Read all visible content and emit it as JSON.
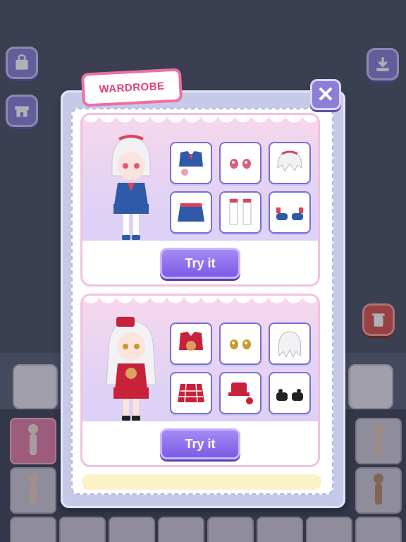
{
  "wardrobe": {
    "title": "WARDROBE",
    "close_label": "✕"
  },
  "outfits": [
    {
      "try_label": "Try it",
      "items": [
        "jacket-outfit-icon",
        "pink-eyes-icon",
        "white-hair-icon",
        "blue-skirt-icon",
        "white-socks-icon",
        "blue-shoes-icon"
      ]
    },
    {
      "try_label": "Try it",
      "items": [
        "red-plaid-jacket-icon",
        "gold-eyes-icon",
        "long-white-hair-icon",
        "red-plaid-skirt-icon",
        "red-hat-icon",
        "black-shoes-icon"
      ]
    }
  ],
  "colors": {
    "accent": "#8b7fd6",
    "title_pink": "#e0407d",
    "card_pink": "#f7d8ec",
    "delete_red": "#d9534f"
  }
}
